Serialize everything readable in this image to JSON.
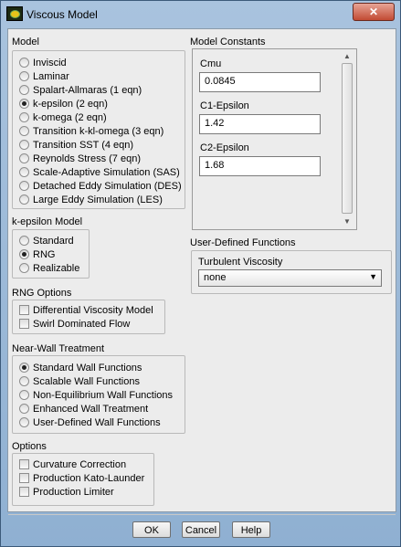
{
  "window": {
    "title": "Viscous Model",
    "close_label": "✕"
  },
  "model": {
    "title": "Model",
    "options": [
      {
        "label": "Inviscid",
        "selected": false
      },
      {
        "label": "Laminar",
        "selected": false
      },
      {
        "label": "Spalart-Allmaras (1 eqn)",
        "selected": false
      },
      {
        "label": "k-epsilon (2 eqn)",
        "selected": true
      },
      {
        "label": "k-omega (2 eqn)",
        "selected": false
      },
      {
        "label": "Transition k-kl-omega (3 eqn)",
        "selected": false
      },
      {
        "label": "Transition SST (4 eqn)",
        "selected": false
      },
      {
        "label": "Reynolds Stress (7 eqn)",
        "selected": false
      },
      {
        "label": "Scale-Adaptive Simulation (SAS)",
        "selected": false
      },
      {
        "label": "Detached Eddy Simulation (DES)",
        "selected": false
      },
      {
        "label": "Large Eddy Simulation (LES)",
        "selected": false
      }
    ]
  },
  "k_epsilon_model": {
    "title": "k-epsilon Model",
    "options": [
      {
        "label": "Standard",
        "selected": false
      },
      {
        "label": "RNG",
        "selected": true
      },
      {
        "label": "Realizable",
        "selected": false
      }
    ]
  },
  "rng_options": {
    "title": "RNG Options",
    "options": [
      {
        "label": "Differential Viscosity Model",
        "checked": false
      },
      {
        "label": "Swirl Dominated Flow",
        "checked": false
      }
    ]
  },
  "near_wall": {
    "title": "Near-Wall Treatment",
    "options": [
      {
        "label": "Standard Wall Functions",
        "selected": true
      },
      {
        "label": "Scalable Wall Functions",
        "selected": false
      },
      {
        "label": "Non-Equilibrium Wall Functions",
        "selected": false
      },
      {
        "label": "Enhanced Wall Treatment",
        "selected": false
      },
      {
        "label": "User-Defined Wall Functions",
        "selected": false
      }
    ]
  },
  "options": {
    "title": "Options",
    "options": [
      {
        "label": "Curvature Correction",
        "checked": false
      },
      {
        "label": "Production Kato-Launder",
        "checked": false
      },
      {
        "label": "Production Limiter",
        "checked": false
      }
    ]
  },
  "model_constants": {
    "title": "Model Constants",
    "items": [
      {
        "name": "Cmu",
        "value": "0.0845"
      },
      {
        "name": "C1-Epsilon",
        "value": "1.42"
      },
      {
        "name": "C2-Epsilon",
        "value": "1.68"
      }
    ]
  },
  "udf": {
    "title": "User-Defined Functions",
    "turbulent_viscosity_label": "Turbulent Viscosity",
    "turbulent_viscosity_value": "none"
  },
  "buttons": {
    "ok": "OK",
    "cancel": "Cancel",
    "help": "Help"
  }
}
